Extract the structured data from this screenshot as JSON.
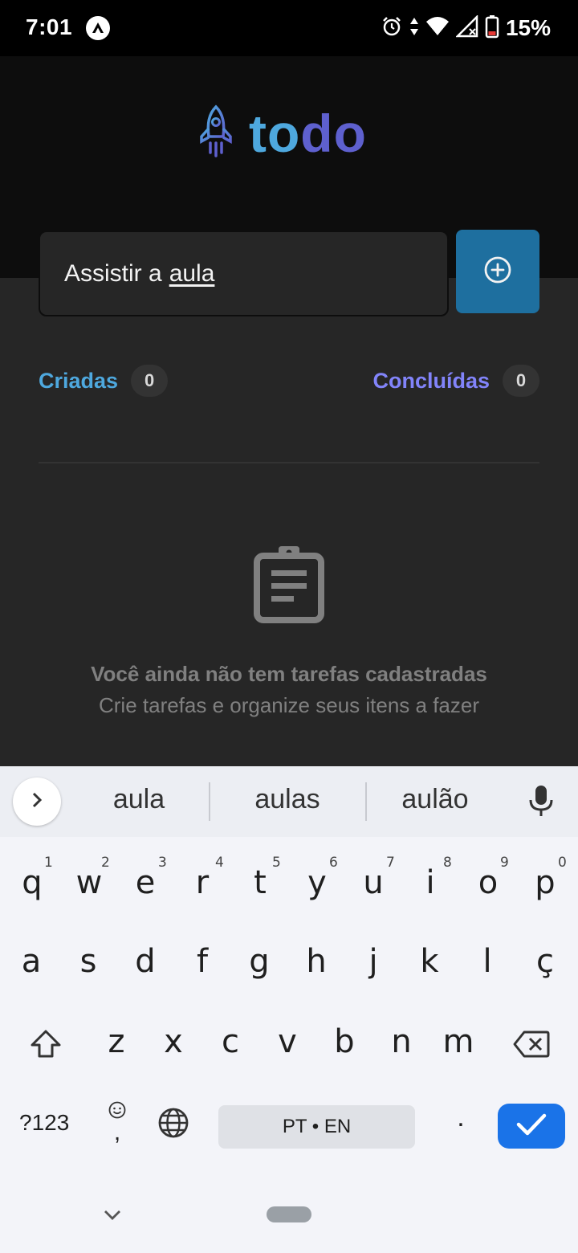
{
  "status_bar": {
    "time": "7:01",
    "battery": "15%",
    "icons": [
      "app-notification-icon",
      "alarm-icon",
      "data-arrows-icon",
      "wifi-icon",
      "cell-signal-icon",
      "battery-icon"
    ]
  },
  "header": {
    "logo_part1": "to",
    "logo_part2": "do",
    "logo_icon": "rocket-icon"
  },
  "task_input": {
    "value_prefix": "Assistir a",
    "value_word": "aula"
  },
  "add_button": {
    "icon": "plus-circle-icon"
  },
  "counters": {
    "created_label": "Criadas",
    "created_count": "0",
    "done_label": "Concluídas",
    "done_count": "0"
  },
  "empty_state": {
    "icon": "clipboard-icon",
    "title": "Você ainda não tem tarefas cadastradas",
    "subtitle": "Crie tarefas e organize seus itens a fazer"
  },
  "keyboard": {
    "suggestions": [
      "aula",
      "aulas",
      "aulão"
    ],
    "row1": [
      "q",
      "w",
      "e",
      "r",
      "t",
      "y",
      "u",
      "i",
      "o",
      "p"
    ],
    "row1_hints": [
      "1",
      "2",
      "3",
      "4",
      "5",
      "6",
      "7",
      "8",
      "9",
      "0"
    ],
    "row2": [
      "a",
      "s",
      "d",
      "f",
      "g",
      "h",
      "j",
      "k",
      "l",
      "ç"
    ],
    "row3": [
      "z",
      "x",
      "c",
      "v",
      "b",
      "n",
      "m"
    ],
    "symbols_label": "?123",
    "emoji_comma": ",",
    "space_label": "PT • EN",
    "period": ".",
    "colors": {
      "enter": "#1a73e8",
      "background": "#f3f4f9"
    }
  },
  "colors": {
    "blue": "#4ea8de",
    "purple": "#5e60ce",
    "purple_light": "#8284fa",
    "blue_dark": "#1e6f9f"
  }
}
